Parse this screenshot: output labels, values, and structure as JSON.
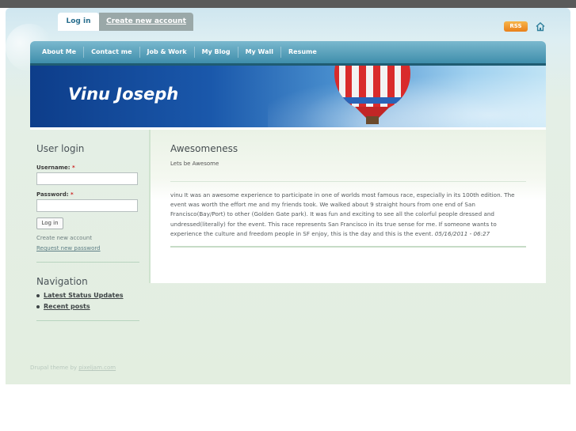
{
  "top_tabs": {
    "login": "Log in",
    "create": "Create new account"
  },
  "rss": "RSS",
  "nav": [
    "About Me",
    "Contact me",
    "Job & Work",
    "My Blog",
    "My Wall",
    "Resume"
  ],
  "site_title": "Vinu Joseph",
  "login_block": {
    "title": "User login",
    "username_label": "Username:",
    "password_label": "Password:",
    "required_mark": "*",
    "button": "Log in",
    "create_account": "Create new account",
    "request_password": "Request new password"
  },
  "navigation_block": {
    "title": "Navigation",
    "items": [
      "Latest Status Updates",
      "Recent posts"
    ]
  },
  "post": {
    "title": "Awesomeness",
    "subtitle": "Lets be Awesome",
    "body": "vinu It was an awesome experience to participate in one of worlds most famous race, especially in its 100th edition. The event was worth the effort me and my friends took. We walked about 9 straight hours from one end of San Francisco(Bay/Port) to other (Golden Gate park). It was fun and exciting to see all the colorful people dressed and undressed(literally) for the event. This race represents San Francisco in its true sense for me. If someone wants to experience the culture and freedom people in SF enjoy, this is the day and this is the event.",
    "date": "05/16/2011 - 06:27"
  },
  "footer": {
    "prefix": "Drupal theme by",
    "link": "pixeljam.com"
  },
  "colors": {
    "nav_blue": "#3f8eab",
    "rss_orange": "#e9801a",
    "title_white": "#ffffff"
  }
}
